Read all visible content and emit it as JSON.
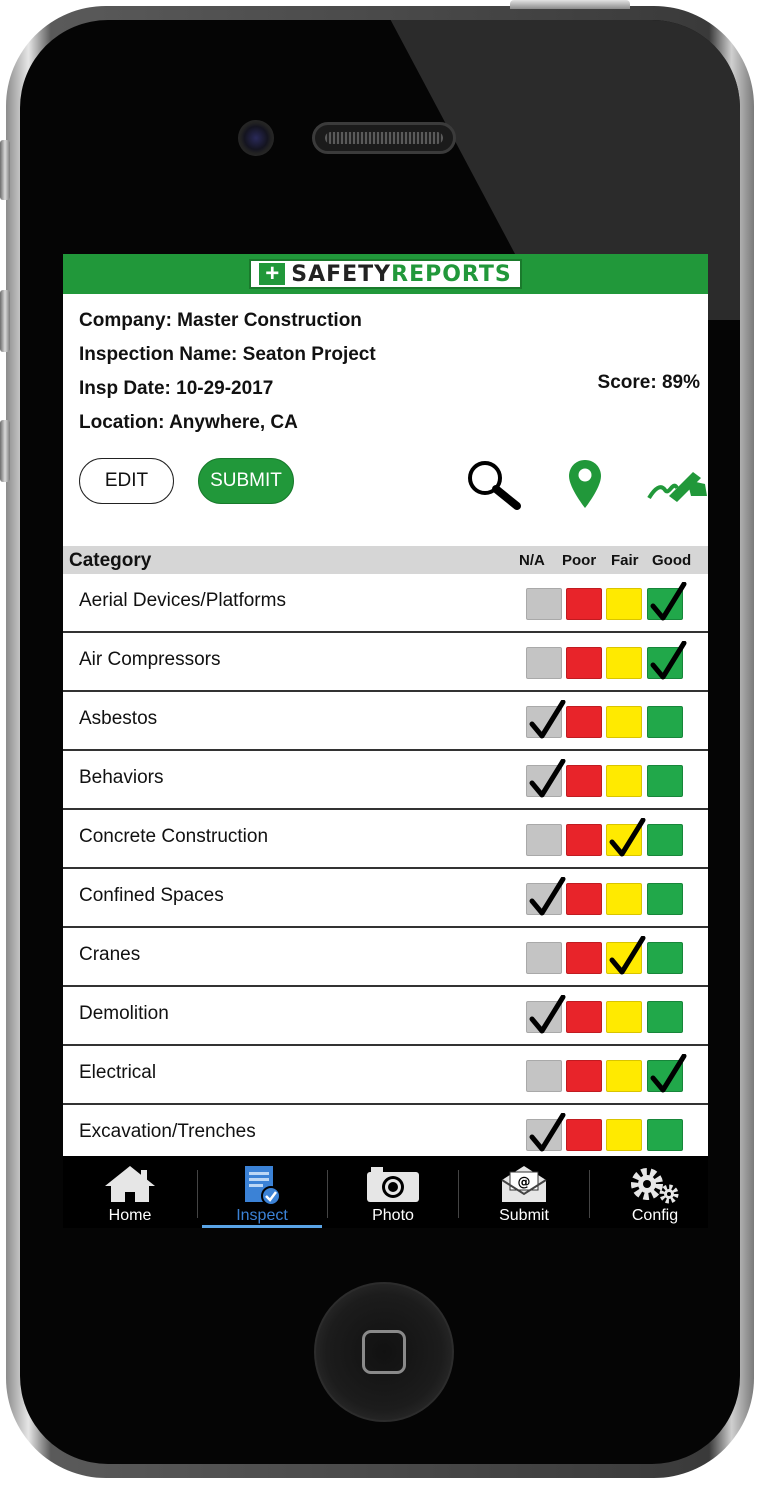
{
  "app": {
    "brand": {
      "part1": "SAFETY",
      "part2": "REPORTS"
    },
    "colors": {
      "brand_green": "#21983a",
      "na": "#c4c4c4",
      "poor": "#e8242a",
      "fair": "#ffea00",
      "good": "#21a84a",
      "active_tab": "#3b82d6"
    }
  },
  "info": {
    "company": "Company: Master Construction",
    "inspection_name": "Inspection Name: Seaton Project",
    "date": "Insp Date: 10-29-2017",
    "location": "Location: Anywhere, CA",
    "score": "Score: 89%"
  },
  "actions": {
    "edit_label": "EDIT",
    "submit_label": "SUBMIT",
    "icons": [
      "search-icon",
      "map-pin-icon",
      "signature-icon"
    ]
  },
  "table": {
    "header": "Category",
    "columns": [
      "N/A",
      "Poor",
      "Fair",
      "Good"
    ],
    "rows": [
      {
        "label": "Aerial Devices/Platforms",
        "selected": "Good"
      },
      {
        "label": "Air Compressors",
        "selected": "Good"
      },
      {
        "label": "Asbestos",
        "selected": "N/A"
      },
      {
        "label": "Behaviors",
        "selected": "N/A"
      },
      {
        "label": "Concrete Construction",
        "selected": "Fair"
      },
      {
        "label": "Confined Spaces",
        "selected": "N/A"
      },
      {
        "label": "Cranes",
        "selected": "Fair"
      },
      {
        "label": "Demolition",
        "selected": "N/A"
      },
      {
        "label": "Electrical",
        "selected": "Good"
      },
      {
        "label": "Excavation/Trenches",
        "selected": "N/A"
      }
    ]
  },
  "tabs": [
    {
      "label": "Home",
      "icon": "home-icon"
    },
    {
      "label": "Inspect",
      "icon": "inspect-icon",
      "active": true
    },
    {
      "label": "Photo",
      "icon": "camera-icon"
    },
    {
      "label": "Submit",
      "icon": "envelope-icon"
    },
    {
      "label": "Config",
      "icon": "gears-icon"
    }
  ]
}
